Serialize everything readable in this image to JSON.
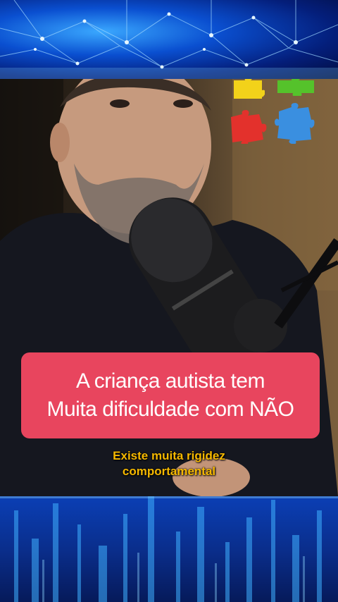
{
  "caption": {
    "line1": "A criança autista tem",
    "line2": "Muita dificuldade com NÃO"
  },
  "subcaption": {
    "line1": "Existe muita rigidez",
    "line2": "comportamental"
  },
  "colors": {
    "caption_bg": "#e8455e",
    "caption_text": "#ffffff",
    "subcaption_text": "#f5b800",
    "top_band": "#0a4fd0",
    "bottom_band": "#0b3fb5"
  },
  "decorations": {
    "puzzle_pieces": [
      "yellow-puzzle-icon",
      "green-puzzle-icon",
      "red-puzzle-icon",
      "blue-puzzle-icon"
    ]
  }
}
